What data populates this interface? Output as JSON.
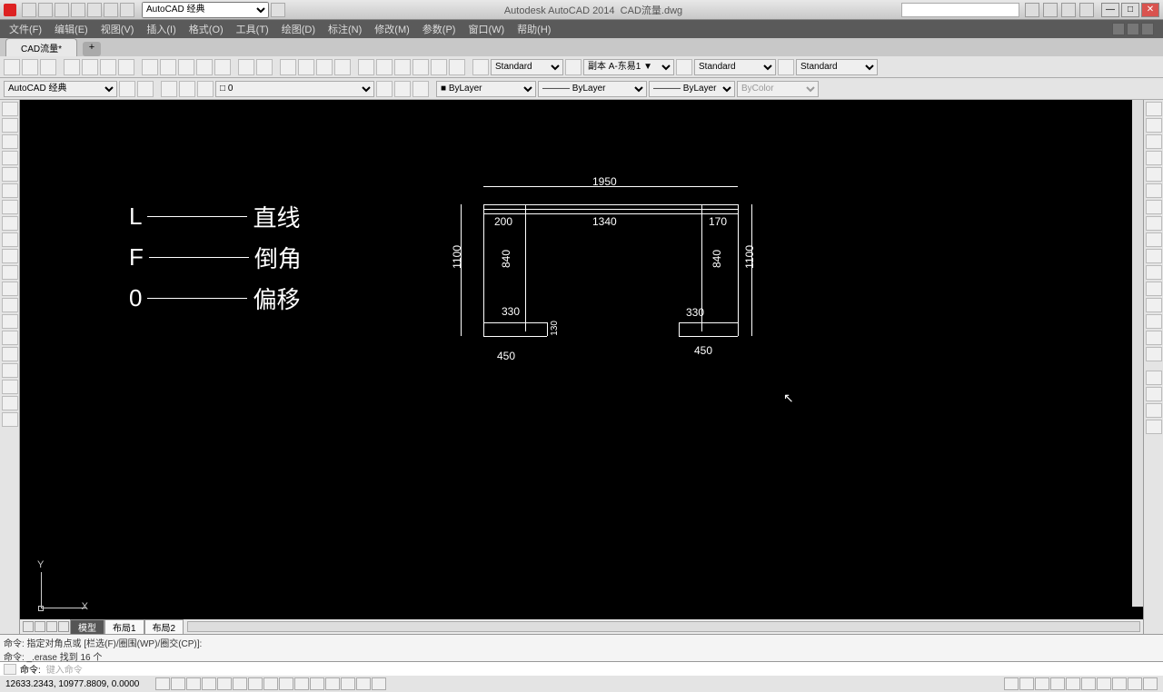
{
  "app": {
    "workspace": "AutoCAD 经典",
    "title_prefix": "Autodesk AutoCAD 2014",
    "file_title": "CAD流量.dwg",
    "search_placeholder": ""
  },
  "menu": [
    "文件(F)",
    "编辑(E)",
    "视图(V)",
    "插入(I)",
    "格式(O)",
    "工具(T)",
    "绘图(D)",
    "标注(N)",
    "修改(M)",
    "参数(P)",
    "窗口(W)",
    "帮助(H)"
  ],
  "filetab": "CAD流量*",
  "toolbar1": {
    "text_style": "Standard",
    "dim_style": "副本 A-东易1 ▼",
    "table_style": "Standard",
    "mleader_style": "Standard"
  },
  "toolbar2": {
    "workspace": "AutoCAD 经典",
    "layer": "□ 0",
    "color": "■ ByLayer",
    "linetype": "——— ByLayer",
    "lineweight": "——— ByLayer",
    "plotstyle": "ByColor"
  },
  "legend": [
    {
      "key": "L",
      "label": "直线"
    },
    {
      "key": "F",
      "label": "倒角"
    },
    {
      "key": "0",
      "label": "偏移"
    }
  ],
  "dims": {
    "top_overall": "1950",
    "top_left": "200",
    "top_mid": "1340",
    "top_right": "170",
    "left_outer": "1100",
    "left_inner": "840",
    "right_outer": "1100",
    "right_inner": "840",
    "bot_left": "330",
    "bot_right": "330",
    "bot_left_outer": "450",
    "bot_right_outer": "450",
    "small": "130"
  },
  "ucs": {
    "x": "X",
    "y": "Y"
  },
  "model_tabs": [
    "模型",
    "布局1",
    "布局2"
  ],
  "cmd_history": [
    "命令: 指定对角点或 [栏选(F)/圈围(WP)/圈交(CP)]:",
    "命令: _.erase 找到 16 个"
  ],
  "cmd_prompt": "命令:",
  "cmd_ghost": "键入命令",
  "status": {
    "coords": "12633.2343, 10977.8809, 0.0000"
  }
}
